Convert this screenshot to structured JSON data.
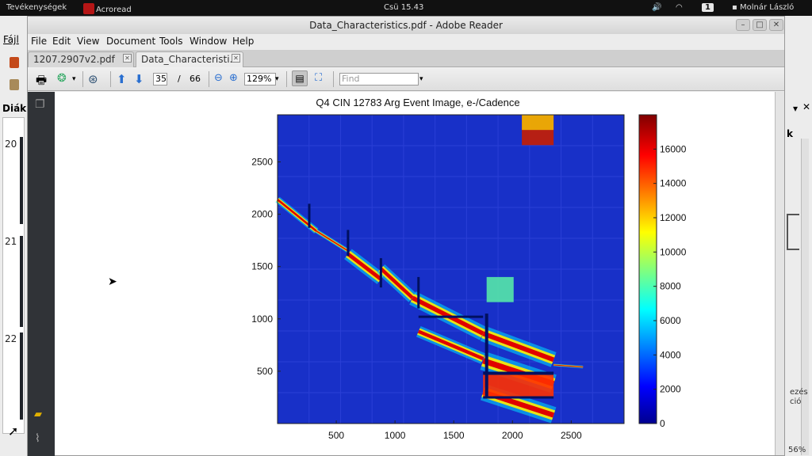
{
  "topbar": {
    "activities": "Tevékenységek",
    "app": "Acroread",
    "clock": "Csü 15.43",
    "workspace": "1",
    "user": "Molnár László"
  },
  "background_app": {
    "menu_file": "Fájl",
    "slides_label": "Diák",
    "slide_numbers": [
      "20",
      "21",
      "22"
    ],
    "right_heading": "k",
    "right_side_text": "ezés\nció",
    "zoom": "56%"
  },
  "window": {
    "title": "Data_Characteristics.pdf -  Adobe Reader",
    "menu": [
      "File",
      "Edit",
      "View",
      "Document",
      "Tools",
      "Window",
      "Help"
    ],
    "tabs": [
      {
        "label": "1207.2907v2.pdf"
      },
      {
        "label": "Data_Characteristi..."
      }
    ],
    "toolbar": {
      "page_current": "35",
      "page_separator": "/",
      "page_total": "66",
      "zoom": "129%",
      "find_placeholder": "Find"
    }
  },
  "chart_data": {
    "type": "heatmap",
    "title": "Q4 CIN 12783 Arg Event Image, e-/Cadence",
    "xlabel": "",
    "ylabel": "",
    "x_ticks": [
      500,
      1000,
      1500,
      2000,
      2500
    ],
    "y_ticks": [
      500,
      1000,
      1500,
      2000,
      2500
    ],
    "xlim": [
      0,
      2950
    ],
    "ylim": [
      0,
      2950
    ],
    "colorbar_ticks": [
      0,
      2000,
      4000,
      6000,
      8000,
      10000,
      12000,
      14000,
      16000
    ],
    "colorbar_range": [
      0,
      18000
    ],
    "colormap": "jet",
    "background_value": 1000
  }
}
